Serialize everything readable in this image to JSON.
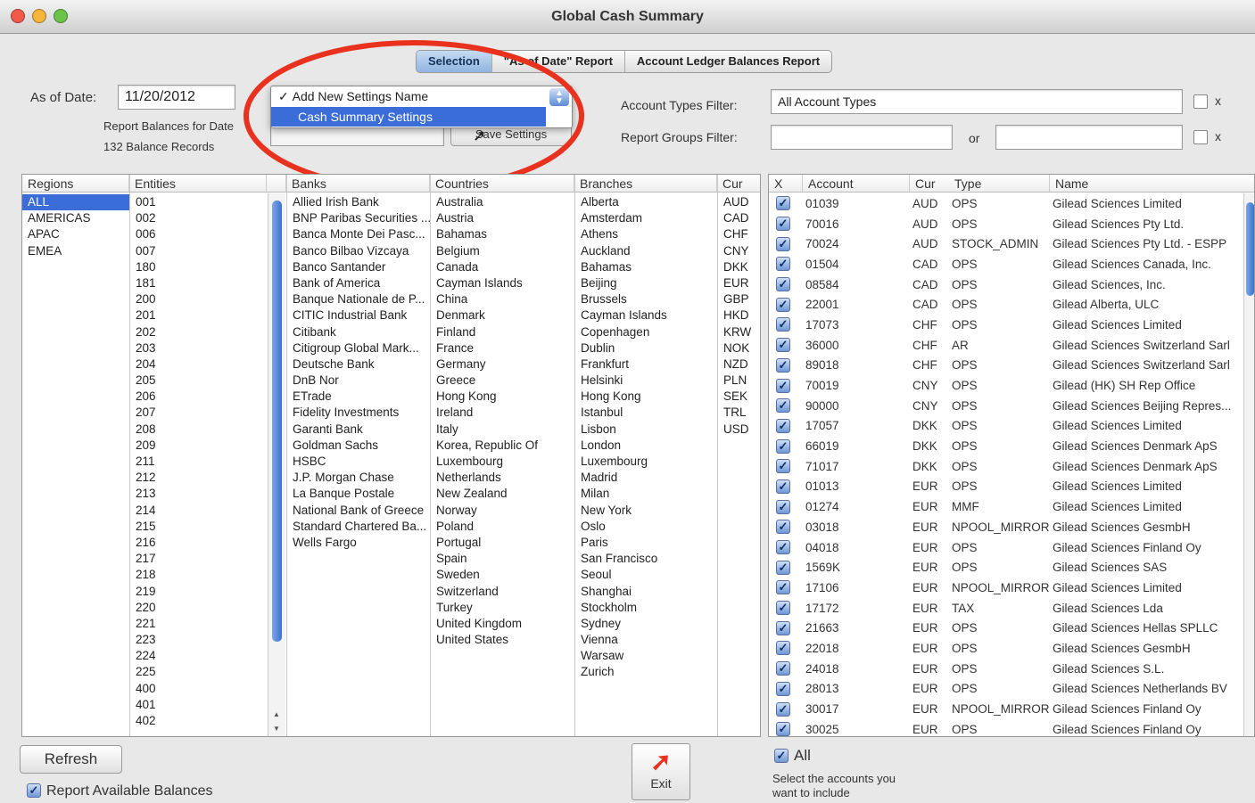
{
  "window": {
    "title": "Global Cash Summary"
  },
  "tabs": [
    {
      "label": "Selection"
    },
    {
      "label": "\"As of Date\" Report"
    },
    {
      "label": "Account Ledger Balances Report"
    }
  ],
  "top": {
    "as_of_label": "As of Date:",
    "as_of_value": "11/20/2012",
    "report_for_label": "Report Balances for Date",
    "balance_records": "132 Balance Records",
    "settings_dropdown": {
      "options": [
        "Add New Settings Name",
        "Cash Summary Settings"
      ],
      "checked": "Add New Settings Name",
      "highlighted": "Cash Summary Settings"
    },
    "save_settings": "Save Settings",
    "account_types_label": "Account Types Filter:",
    "account_types_value": "All Account Types",
    "report_groups_label": "Report Groups Filter:",
    "or_label": "or",
    "x_label": "x"
  },
  "columns": {
    "regions": {
      "header": "Regions",
      "items": [
        "ALL",
        "AMERICAS",
        "APAC",
        "EMEA"
      ],
      "selected": "ALL"
    },
    "entities": {
      "header": "Entities",
      "items": [
        "001",
        "002",
        "006",
        "007",
        "180",
        "181",
        "200",
        "201",
        "202",
        "203",
        "204",
        "205",
        "206",
        "207",
        "208",
        "209",
        "211",
        "212",
        "213",
        "214",
        "215",
        "216",
        "217",
        "218",
        "219",
        "220",
        "221",
        "223",
        "224",
        "225",
        "400",
        "401",
        "402"
      ]
    },
    "banks": {
      "header": "Banks",
      "items": [
        "Allied Irish Bank",
        "BNP Paribas Securities ...",
        "Banca Monte Dei Pasc...",
        "Banco Bilbao Vizcaya",
        "Banco Santander",
        "Bank of America",
        "Banque Nationale de P...",
        "CITIC Industrial Bank",
        "Citibank",
        "Citigroup Global Mark...",
        "Deutsche Bank",
        "DnB Nor",
        "ETrade",
        "Fidelity Investments",
        "Garanti Bank",
        "Goldman Sachs",
        "HSBC",
        "J.P. Morgan Chase",
        "La Banque Postale",
        "National Bank of Greece",
        "Standard Chartered Ba...",
        "Wells Fargo"
      ]
    },
    "countries": {
      "header": "Countries",
      "items": [
        "Australia",
        "Austria",
        "Bahamas",
        "Belgium",
        "Canada",
        "Cayman Islands",
        "China",
        "Denmark",
        "Finland",
        "France",
        "Germany",
        "Greece",
        "Hong Kong",
        "Ireland",
        "Italy",
        "Korea, Republic Of",
        "Luxembourg",
        "Netherlands",
        "New Zealand",
        "Norway",
        "Poland",
        "Portugal",
        "Spain",
        "Sweden",
        "Switzerland",
        "Turkey",
        "United Kingdom",
        "United States"
      ]
    },
    "branches": {
      "header": "Branches",
      "items": [
        "Alberta",
        "Amsterdam",
        "Athens",
        "Auckland",
        "Bahamas",
        "Beijing",
        "Brussels",
        "Cayman Islands",
        "Copenhagen",
        "Dublin",
        "Frankfurt",
        "Helsinki",
        "Hong Kong",
        "Istanbul",
        "Lisbon",
        "London",
        "Luxembourg",
        "Madrid",
        "Milan",
        "New York",
        "Oslo",
        "Paris",
        "San Francisco",
        "Seoul",
        "Shanghai",
        "Stockholm",
        "Sydney",
        "Vienna",
        "Warsaw",
        "Zurich"
      ]
    },
    "currencies": {
      "header": "Cur",
      "items": [
        "AUD",
        "CAD",
        "CHF",
        "CNY",
        "DKK",
        "EUR",
        "GBP",
        "HKD",
        "KRW",
        "NOK",
        "NZD",
        "PLN",
        "SEK",
        "TRL",
        "USD"
      ]
    }
  },
  "accounts": {
    "headers": {
      "x": "X",
      "account": "Account",
      "cur": "Cur",
      "type": "Type",
      "name": "Name"
    },
    "rows": [
      {
        "account": "01039",
        "cur": "AUD",
        "type": "OPS",
        "name": "Gilead Sciences Limited"
      },
      {
        "account": "70016",
        "cur": "AUD",
        "type": "OPS",
        "name": "Gilead Sciences Pty Ltd."
      },
      {
        "account": "70024",
        "cur": "AUD",
        "type": "STOCK_ADMIN",
        "name": "Gilead Sciences Pty Ltd. - ESPP"
      },
      {
        "account": "01504",
        "cur": "CAD",
        "type": "OPS",
        "name": "Gilead Sciences Canada, Inc."
      },
      {
        "account": "08584",
        "cur": "CAD",
        "type": "OPS",
        "name": "Gilead Sciences, Inc."
      },
      {
        "account": "22001",
        "cur": "CAD",
        "type": "OPS",
        "name": "Gilead Alberta, ULC"
      },
      {
        "account": "17073",
        "cur": "CHF",
        "type": "OPS",
        "name": "Gilead Sciences Limited"
      },
      {
        "account": "36000",
        "cur": "CHF",
        "type": "AR",
        "name": "Gilead Sciences Switzerland Sarl"
      },
      {
        "account": "89018",
        "cur": "CHF",
        "type": "OPS",
        "name": "Gilead Sciences Switzerland Sarl"
      },
      {
        "account": "70019",
        "cur": "CNY",
        "type": "OPS",
        "name": "Gilead (HK) SH Rep Office"
      },
      {
        "account": "90000",
        "cur": "CNY",
        "type": "OPS",
        "name": "Gilead Sciences Beijing Repres..."
      },
      {
        "account": "17057",
        "cur": "DKK",
        "type": "OPS",
        "name": "Gilead Sciences Limited"
      },
      {
        "account": "66019",
        "cur": "DKK",
        "type": "OPS",
        "name": "Gilead Sciences Denmark ApS"
      },
      {
        "account": "71017",
        "cur": "DKK",
        "type": "OPS",
        "name": "Gilead Sciences Denmark ApS"
      },
      {
        "account": "01013",
        "cur": "EUR",
        "type": "OPS",
        "name": "Gilead Sciences Limited"
      },
      {
        "account": "01274",
        "cur": "EUR",
        "type": "MMF",
        "name": "Gilead Sciences Limited"
      },
      {
        "account": "03018",
        "cur": "EUR",
        "type": "NPOOL_MIRROR",
        "name": "Gilead Sciences GesmbH"
      },
      {
        "account": "04018",
        "cur": "EUR",
        "type": "OPS",
        "name": "Gilead Sciences Finland Oy"
      },
      {
        "account": "1569K",
        "cur": "EUR",
        "type": "OPS",
        "name": "Gilead Sciences SAS"
      },
      {
        "account": "17106",
        "cur": "EUR",
        "type": "NPOOL_MIRROR",
        "name": "Gilead Sciences Limited"
      },
      {
        "account": "17172",
        "cur": "EUR",
        "type": "TAX",
        "name": "Gilead Sciences Lda"
      },
      {
        "account": "21663",
        "cur": "EUR",
        "type": "OPS",
        "name": "Gilead Sciences Hellas SPLLC"
      },
      {
        "account": "22018",
        "cur": "EUR",
        "type": "OPS",
        "name": "Gilead Sciences GesmbH"
      },
      {
        "account": "24018",
        "cur": "EUR",
        "type": "OPS",
        "name": "Gilead Sciences S.L."
      },
      {
        "account": "28013",
        "cur": "EUR",
        "type": "OPS",
        "name": "Gilead Sciences Netherlands BV"
      },
      {
        "account": "30017",
        "cur": "EUR",
        "type": "NPOOL_MIRROR",
        "name": "Gilead Sciences Finland Oy"
      },
      {
        "account": "30025",
        "cur": "EUR",
        "type": "OPS",
        "name": "Gilead Sciences Finland Oy"
      }
    ]
  },
  "bottom": {
    "refresh": "Refresh",
    "report_available": "Report Available Balances",
    "exit": "Exit",
    "all_label": "All",
    "select_hint": "Select the accounts you want to include"
  },
  "colors": {
    "selection": "#3a6dd8",
    "annotation": "#e8321e",
    "checkbox": "#6e97d6"
  }
}
